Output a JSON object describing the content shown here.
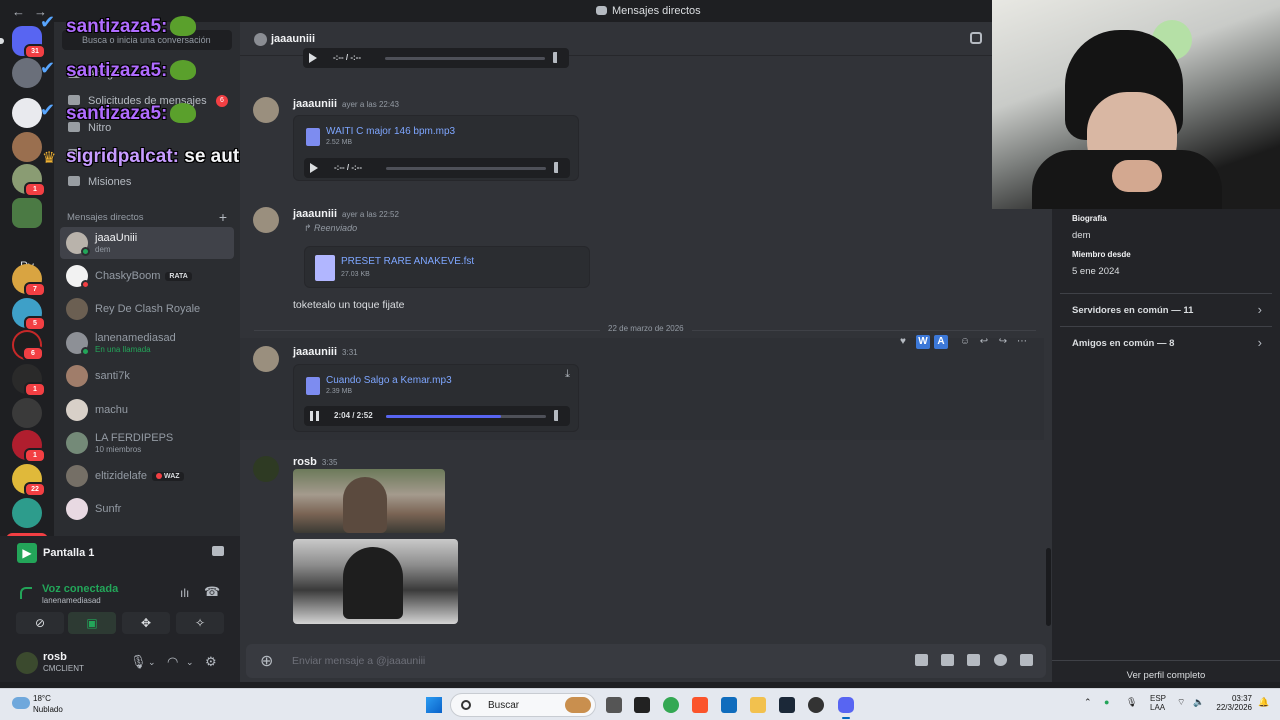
{
  "window": {
    "title": "Mensajes directos"
  },
  "rail": {
    "badges": [
      "31",
      "1",
      "7",
      "5",
      "6",
      "1",
      "1",
      "22"
    ],
    "pv_label": "Pv",
    "nuevo_label": "NUEVO"
  },
  "sidebar": {
    "search_placeholder": "Busca o inicia una conversación",
    "menu": [
      {
        "label": "Amigos"
      },
      {
        "label": "Solicitudes de mensajes",
        "count": "6"
      },
      {
        "label": "Nitro"
      },
      {
        "label": "Tienda"
      },
      {
        "label": "Misiones"
      }
    ],
    "dm_header": "Mensajes directos",
    "dms": [
      {
        "name": "jaaaUniii",
        "sub": "dem",
        "active": true
      },
      {
        "name": "ChaskyBoom",
        "tag": "RATA"
      },
      {
        "name": "Rey De Clash Royale"
      },
      {
        "name": "lanenamediasad",
        "sub": "En una llamada"
      },
      {
        "name": "santi7k"
      },
      {
        "name": "machu"
      },
      {
        "name": "LA FERDIPEPS",
        "sub": "10 miembros"
      },
      {
        "name": "eltizidelafe",
        "tag": "WAZ"
      },
      {
        "name": "Sunfr"
      }
    ]
  },
  "overlay": {
    "user1": "santizaza5:",
    "user2": "santizaza5:",
    "user3": "santizaza5:",
    "chat_user": "sigridpalcat:",
    "chat_text": "se auto decía cabra"
  },
  "voice": {
    "screen_label": "Pantalla 1",
    "status": "Voz conectada",
    "channel": "lanenamediasad"
  },
  "user": {
    "name": "rosb",
    "status": "CMCLIENT"
  },
  "chat": {
    "header_name": "jaaauniii",
    "messages": [
      {
        "author": "jaaauniii",
        "time": "ayer a las 22:43",
        "file": "WAITI C major 146 bpm.mp3",
        "size": "2.52 MB",
        "player_time": "-:-- / -:--"
      },
      {
        "author": "jaaauniii",
        "time": "ayer a las 22:52",
        "forwarded": "Reenviado",
        "file": "PRESET RARE ANAKEVE.fst",
        "size": "27.03 KB",
        "text": "toketealo un toque fijate"
      },
      {
        "author": "jaaauniii",
        "time": "3:31",
        "file": "Cuando Salgo a Kemar.mp3",
        "size": "2.39 MB",
        "player_time": "2:04 / 2:52",
        "progress": 0.72
      },
      {
        "author": "rosb",
        "time": "3:35"
      }
    ],
    "top_player_time": "-:-- / -:--",
    "date_divider": "22 de marzo de 2026",
    "composer_placeholder": "Enviar mensaje a @jaaauniii"
  },
  "profile": {
    "bio_label": "Biografía",
    "bio": "dem",
    "member_label": "Miembro desde",
    "member_since": "5 ene 2024",
    "servers": "Servidores en común — 11",
    "friends": "Amigos en común — 8",
    "view_full": "Ver perfil completo"
  },
  "taskbar": {
    "temp": "18°C",
    "weather": "Nublado",
    "search": "Buscar",
    "lang1": "ESP",
    "lang2": "LAA",
    "time": "03:37",
    "date": "22/3/2026"
  }
}
